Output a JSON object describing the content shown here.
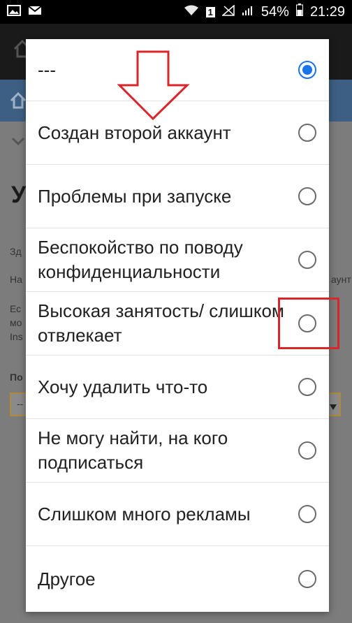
{
  "status_bar": {
    "battery": "54%",
    "time": "21:29",
    "notification_count": "1"
  },
  "dialog": {
    "options": [
      {
        "label": "---",
        "checked": true
      },
      {
        "label": "Создан второй аккаунт",
        "checked": false
      },
      {
        "label": "Проблемы при запуске",
        "checked": false
      },
      {
        "label": "Беспокойство по поводу конфиденциальности",
        "checked": false
      },
      {
        "label": "Высокая занятость/ слишком отвлекает",
        "checked": false
      },
      {
        "label": "Хочу удалить что-то",
        "checked": false
      },
      {
        "label": "Не могу найти, на кого подписаться",
        "checked": false
      },
      {
        "label": "Слишком много рекламы",
        "checked": false
      },
      {
        "label": "Другое",
        "checked": false
      }
    ]
  },
  "background": {
    "title_fragment": "У",
    "text_1": "Зд",
    "text_2": "На",
    "text_2_right": "аунт",
    "text_3a": "Ес",
    "text_3b": "мо",
    "text_3c": "Ins",
    "label_fragment": "По",
    "select_fragment": "--"
  },
  "colors": {
    "radio_selected": "#1a73e8",
    "annotation_red": "#d9262b"
  }
}
